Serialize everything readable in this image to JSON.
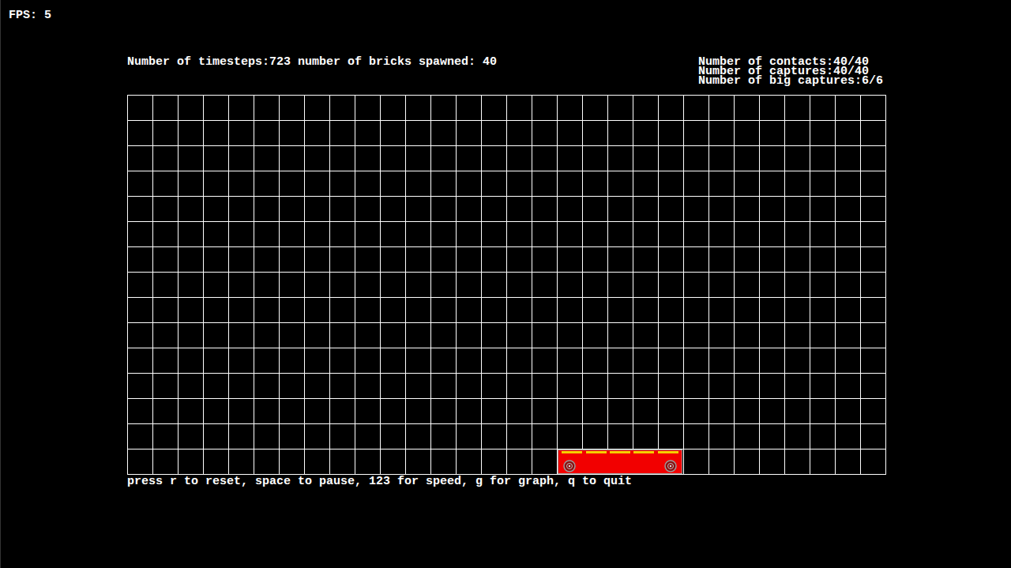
{
  "fps": "FPS: 5",
  "header": {
    "status": "Number of timesteps:723 number of bricks spawned: 40"
  },
  "stats": [
    "Number of contacts:40/40",
    "Number of captures:40/40",
    "Number of big captures:6/6"
  ],
  "board": {
    "columns": 30,
    "rows": 15
  },
  "cart": {
    "column": 17,
    "width_cells": 5,
    "segments": 5,
    "wheels": 2
  },
  "footer": "press r to reset, space to pause, 123 for speed, g for graph, q to quit"
}
